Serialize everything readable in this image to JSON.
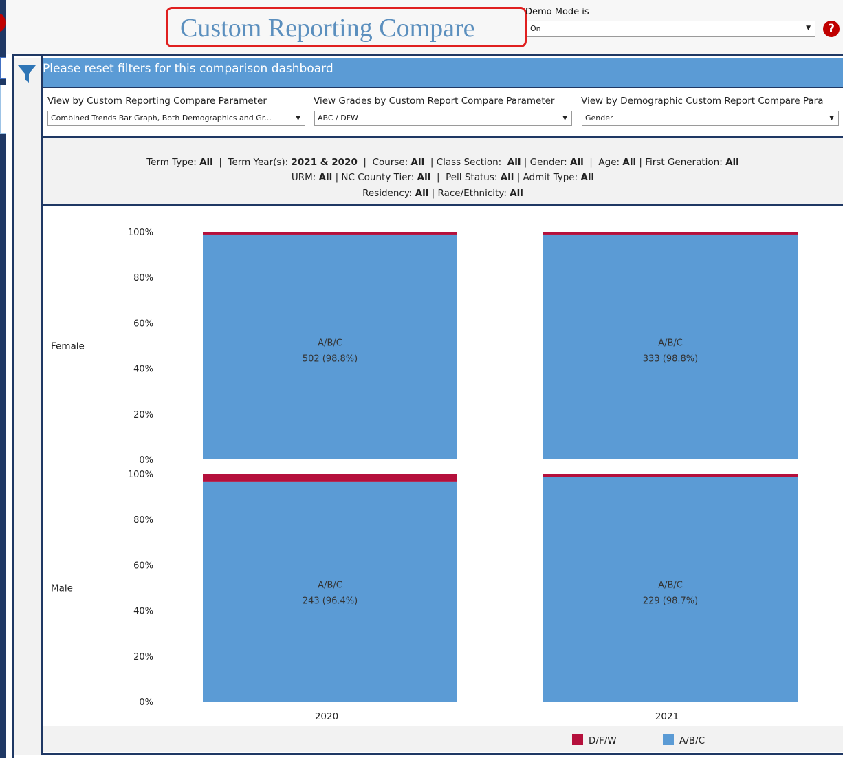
{
  "header": {
    "title": "Custom Reporting Compare",
    "demo_mode_label": "Demo Mode is",
    "demo_mode_value": "On",
    "help_icon": "question-circle-icon"
  },
  "banner": {
    "text": "Please reset filters for this comparison dashboard",
    "icon": "filter-icon"
  },
  "parameters": [
    {
      "label": "View by Custom Reporting Compare Parameter",
      "value": "Combined Trends Bar Graph, Both Demographics and Gr..."
    },
    {
      "label": "View Grades by Custom Report Compare Parameter",
      "value": "ABC / DFW"
    },
    {
      "label": "View by Demographic Custom Report Compare Para",
      "value": "Gender"
    }
  ],
  "filter_summary": {
    "line1": [
      {
        "k": "Term Type: ",
        "v": "All"
      },
      {
        "sep": "  |  "
      },
      {
        "k": "Term Year(s): ",
        "v": "2021 & 2020"
      },
      {
        "sep": "  |  "
      },
      {
        "k": "Course: ",
        "v": "All"
      },
      {
        "sep": "  | "
      },
      {
        "k": "Class Section:  ",
        "v": "All"
      },
      {
        "sep": " | "
      },
      {
        "k": "Gender: ",
        "v": "All"
      },
      {
        "sep": "  |  "
      },
      {
        "k": "Age: ",
        "v": "All"
      },
      {
        "sep": " | "
      },
      {
        "k": "First Generation: ",
        "v": "All"
      }
    ],
    "line2": [
      {
        "k": "URM: ",
        "v": "All"
      },
      {
        "sep": " | "
      },
      {
        "k": "NC County Tier: ",
        "v": "All"
      },
      {
        "sep": "  |  "
      },
      {
        "k": "Pell Status: ",
        "v": "All"
      },
      {
        "sep": " | "
      },
      {
        "k": "Admit Type: ",
        "v": "All"
      }
    ],
    "line3": [
      {
        "k": "Residency: ",
        "v": "All"
      },
      {
        "sep": " | "
      },
      {
        "k": "Race/Ethnicity: ",
        "v": "All"
      }
    ]
  },
  "chart_data": {
    "type": "bar",
    "stacked": true,
    "percent": true,
    "rows": [
      "Female",
      "Male"
    ],
    "categories": [
      "2020",
      "2021"
    ],
    "ylim": [
      0,
      100
    ],
    "yticks": [
      "100%",
      "80%",
      "60%",
      "40%",
      "20%",
      "0%"
    ],
    "yticks_values": [
      100,
      80,
      60,
      40,
      20,
      0
    ],
    "series": [
      {
        "name": "A/B/C",
        "color": "#5b9bd5"
      },
      {
        "name": "D/F/W",
        "color": "#b5103c"
      }
    ],
    "panels": [
      {
        "row": "Female",
        "year": "2020",
        "abc_pct": 98.8,
        "label_name": "A/B/C",
        "label_value": "502 (98.8%)"
      },
      {
        "row": "Female",
        "year": "2021",
        "abc_pct": 98.8,
        "label_name": "A/B/C",
        "label_value": "333 (98.8%)"
      },
      {
        "row": "Male",
        "year": "2020",
        "abc_pct": 96.4,
        "label_name": "A/B/C",
        "label_value": "243 (96.4%)"
      },
      {
        "row": "Male",
        "year": "2021",
        "abc_pct": 98.7,
        "label_name": "A/B/C",
        "label_value": "229 (98.7%)"
      }
    ],
    "legend": [
      {
        "name": "D/F/W",
        "color": "#b5103c"
      },
      {
        "name": "A/B/C",
        "color": "#5b9bd5"
      }
    ]
  }
}
